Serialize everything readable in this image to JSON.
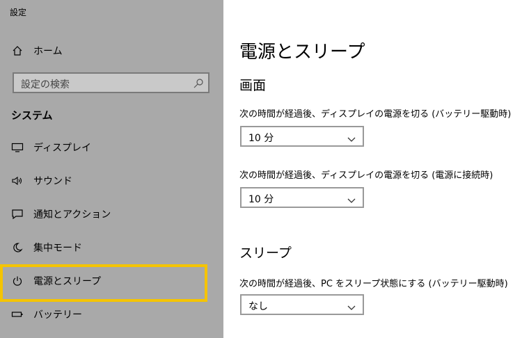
{
  "window": {
    "title": "設定"
  },
  "sidebar": {
    "home_label": "ホーム",
    "search_placeholder": "設定の検索",
    "section_title": "システム",
    "items": [
      {
        "label": "ディスプレイ",
        "icon": "monitor-icon"
      },
      {
        "label": "サウンド",
        "icon": "speaker-icon"
      },
      {
        "label": "通知とアクション",
        "icon": "notification-icon"
      },
      {
        "label": "集中モード",
        "icon": "moon-icon"
      },
      {
        "label": "電源とスリープ",
        "icon": "power-icon",
        "highlighted": true
      },
      {
        "label": "バッテリー",
        "icon": "battery-icon"
      }
    ],
    "highlight_color": "#f5c400"
  },
  "main": {
    "title": "電源とスリープ",
    "screen": {
      "heading": "画面",
      "battery_label": "次の時間が経過後、ディスプレイの電源を切る (バッテリー駆動時)",
      "battery_value": "10 分",
      "plugged_label": "次の時間が経過後、ディスプレイの電源を切る (電源に接続時)",
      "plugged_value": "10 分"
    },
    "sleep": {
      "heading": "スリープ",
      "battery_label": "次の時間が経過後、PC をスリープ状態にする (バッテリー駆動時)",
      "battery_value": "なし"
    }
  }
}
